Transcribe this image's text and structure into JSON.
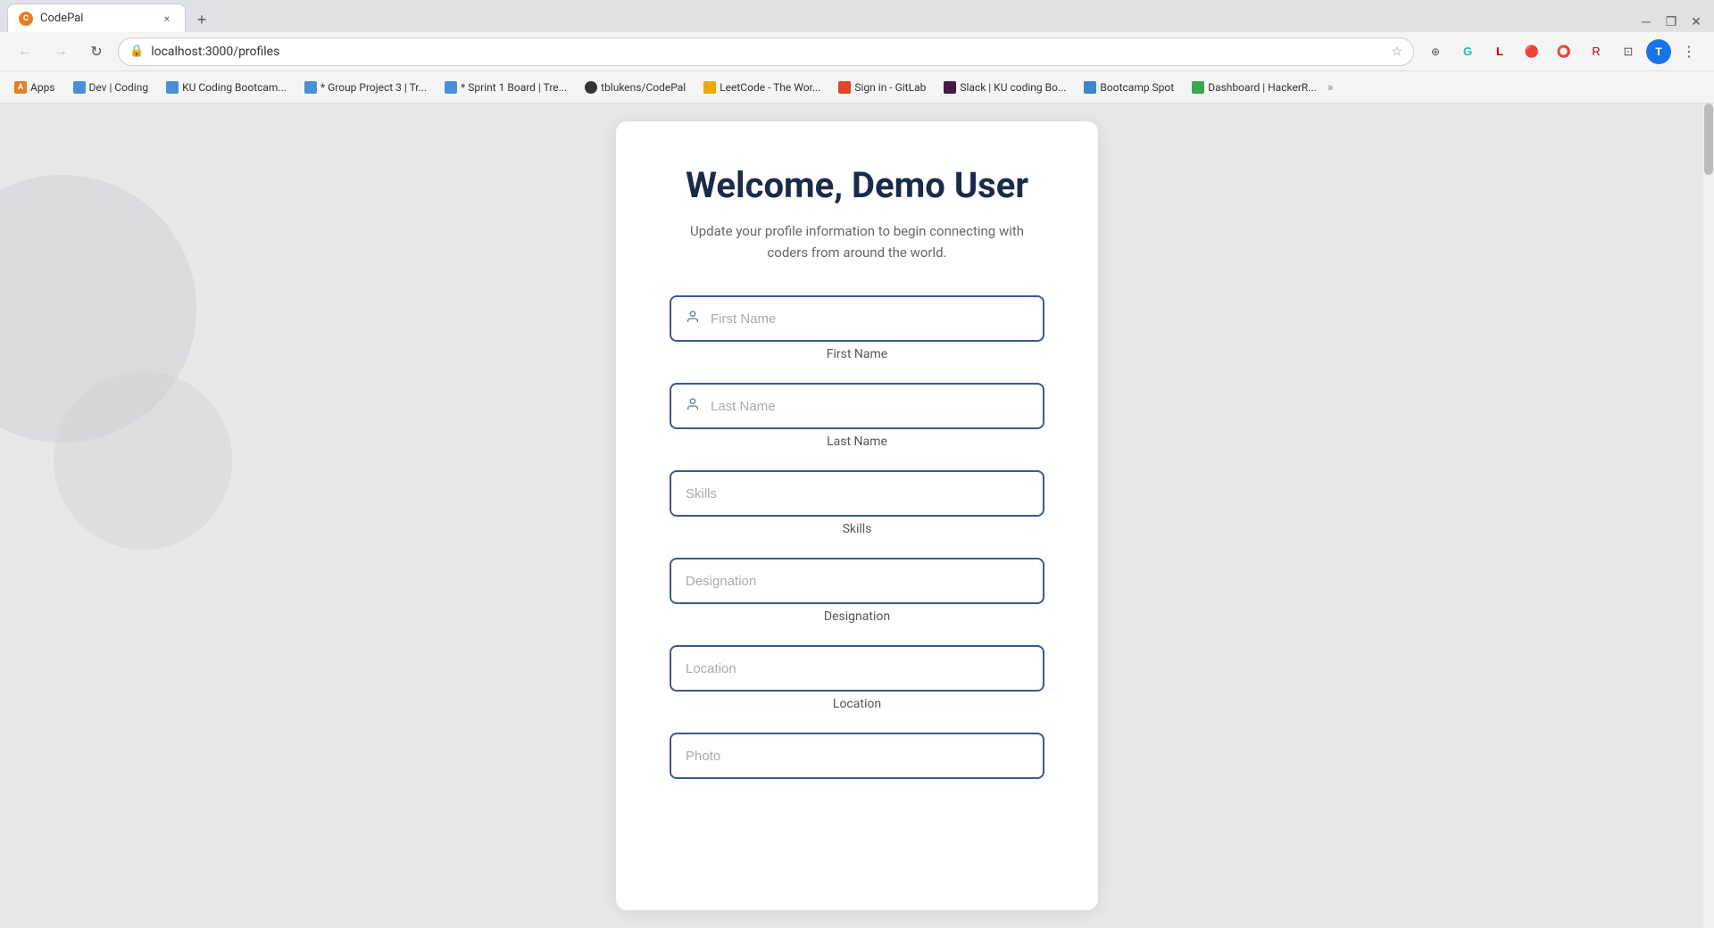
{
  "browser": {
    "tab": {
      "favicon_text": "C",
      "title": "CodePal",
      "close_label": "×",
      "new_tab_label": "+"
    },
    "nav": {
      "back_label": "←",
      "forward_label": "→",
      "reload_label": "↻",
      "url": "localhost:3000/profiles",
      "star_label": "☆",
      "more_label": "⋮"
    },
    "bookmarks": [
      {
        "label": "Apps",
        "icon_color": "#e67e22"
      },
      {
        "label": "Dev | Coding",
        "icon_color": "#4a90d9"
      },
      {
        "label": "KU Coding Bootcam...",
        "icon_color": "#4a90d9"
      },
      {
        "label": "* Group Project 3 | Tr...",
        "icon_color": "#4a90d9"
      },
      {
        "label": "* Sprint 1 Board | Tre...",
        "icon_color": "#4a90d9"
      },
      {
        "label": "tblukens/CodePal",
        "icon_color": "#333"
      },
      {
        "label": "LeetCode - The Wor...",
        "icon_color": "#f0a500"
      },
      {
        "label": "Sign in - GitLab",
        "icon_color": "#e24329"
      },
      {
        "label": "Slack | KU coding Bo...",
        "icon_color": "#4a154b"
      },
      {
        "label": "Bootcamp Spot",
        "icon_color": "#3a86c8"
      },
      {
        "label": "Dashboard | HackerR...",
        "icon_color": "#39a84a"
      }
    ]
  },
  "page": {
    "title": "Welcome, Demo User",
    "subtitle_line1": "Update your profile information to begin connecting with",
    "subtitle_line2": "coders from around the world.",
    "fields": [
      {
        "id": "first-name",
        "placeholder": "First Name",
        "label": "First Name",
        "has_icon": true
      },
      {
        "id": "last-name",
        "placeholder": "Last Name",
        "label": "Last Name",
        "has_icon": true
      },
      {
        "id": "skills",
        "placeholder": "Skills",
        "label": "Skills",
        "has_icon": false
      },
      {
        "id": "designation",
        "placeholder": "Designation",
        "label": "Designation",
        "has_icon": false
      },
      {
        "id": "location",
        "placeholder": "Location",
        "label": "Location",
        "has_icon": false
      },
      {
        "id": "photo",
        "placeholder": "Photo",
        "label": "",
        "has_icon": false
      }
    ]
  }
}
